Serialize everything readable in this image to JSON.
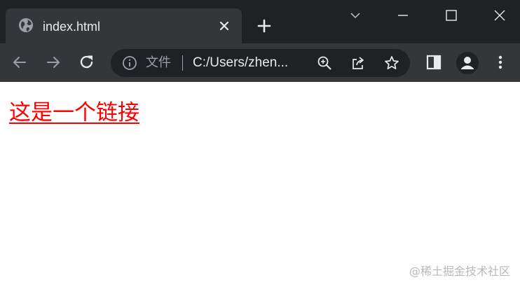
{
  "tab": {
    "title": "index.html",
    "favicon": "globe-icon"
  },
  "window_controls": [
    "tab-search-icon",
    "minimize-icon",
    "maximize-icon",
    "close-window-icon"
  ],
  "toolbar": {
    "back_icon": "arrow-left-icon",
    "forward_icon": "arrow-right-icon",
    "reload_icon": "reload-icon",
    "side_panel_icon": "side-panel-icon",
    "profile_icon": "profile-icon",
    "menu_icon": "more-vertical-icon"
  },
  "omnibox": {
    "scheme_label": "文件",
    "url": "C:/Users/zhen...",
    "icons": [
      "zoom-in-icon",
      "share-icon",
      "star-icon"
    ]
  },
  "page": {
    "link_text": "这是一个链接",
    "link_color": "#ff0000"
  },
  "watermark": "@稀土掘金技术社区",
  "colors": {
    "tabstrip": "#202124",
    "toolbar": "#35363a",
    "omnibox": "#202124",
    "icon": "#e8eaed",
    "icon_dim": "#9aa0a6"
  }
}
